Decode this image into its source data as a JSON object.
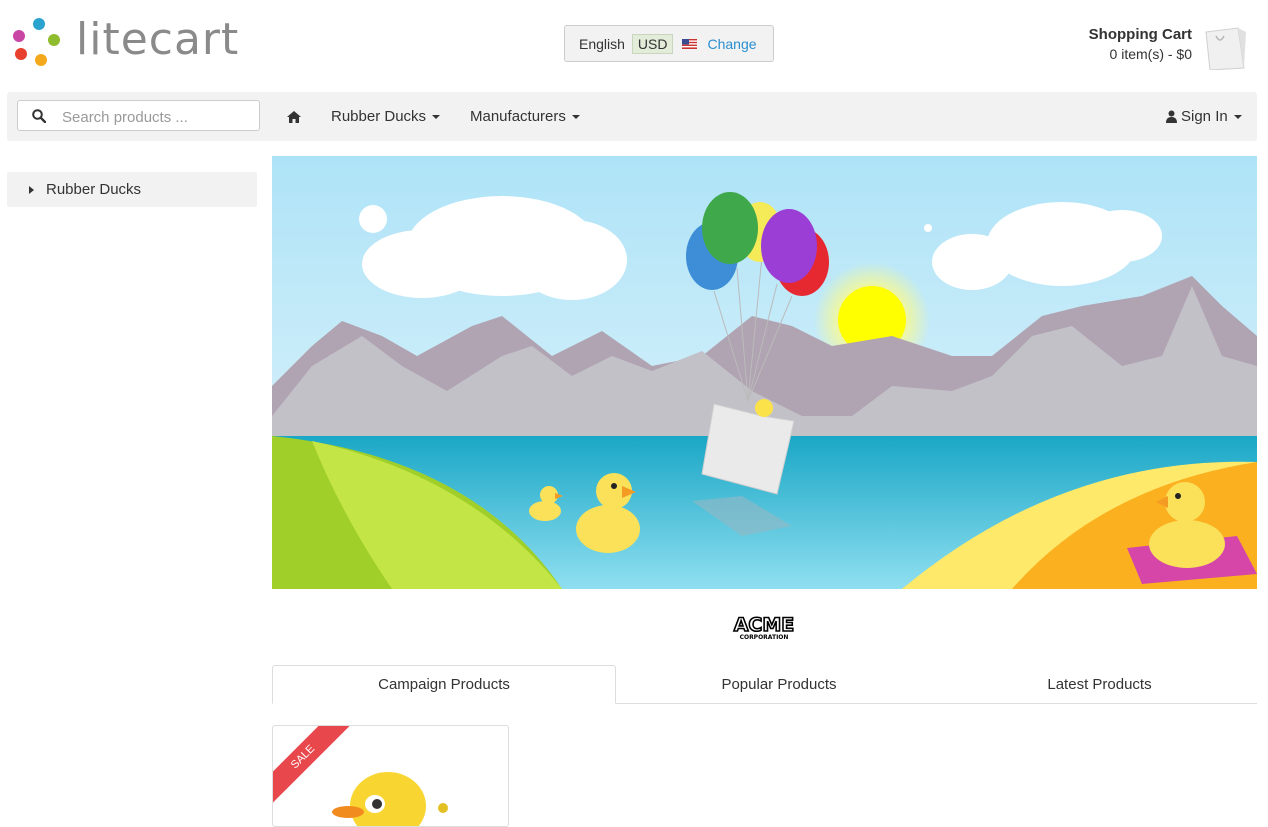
{
  "header": {
    "logo_text": "litecart",
    "region": {
      "language": "English",
      "currency": "USD",
      "change_label": "Change"
    },
    "cart": {
      "title": "Shopping Cart",
      "status": "0 item(s) - $0"
    }
  },
  "navbar": {
    "search_placeholder": "Search products ...",
    "items": [
      {
        "label": "Rubber Ducks"
      },
      {
        "label": "Manufacturers"
      }
    ],
    "sign_in": "Sign In"
  },
  "sidebar": {
    "categories": [
      {
        "label": "Rubber Ducks"
      }
    ]
  },
  "manufacturer_logo": {
    "text": "ACME",
    "subtext": "CORPORATION"
  },
  "tabs": [
    {
      "label": "Campaign Products",
      "active": true
    },
    {
      "label": "Popular Products",
      "active": false
    },
    {
      "label": "Latest Products",
      "active": false
    }
  ],
  "products": [
    {
      "badge": "SALE"
    }
  ],
  "colors": {
    "accent": "#2a8fd2",
    "sale": "#e8484c",
    "nav_bg": "#f2f2f2"
  }
}
